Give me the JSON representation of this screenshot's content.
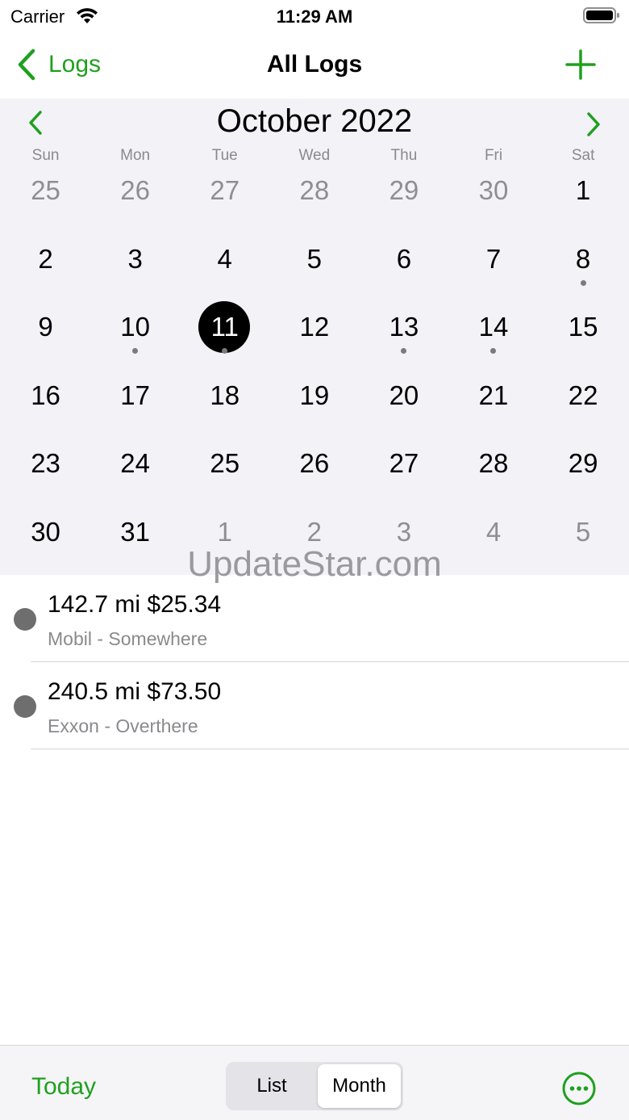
{
  "status_bar": {
    "carrier": "Carrier",
    "time": "11:29 AM"
  },
  "nav": {
    "back_label": "Logs",
    "title": "All Logs"
  },
  "calendar": {
    "month_label": "October 2022",
    "weekdays": [
      "Sun",
      "Mon",
      "Tue",
      "Wed",
      "Thu",
      "Fri",
      "Sat"
    ],
    "weeks": [
      [
        {
          "d": "25",
          "other": true
        },
        {
          "d": "26",
          "other": true
        },
        {
          "d": "27",
          "other": true
        },
        {
          "d": "28",
          "other": true
        },
        {
          "d": "29",
          "other": true
        },
        {
          "d": "30",
          "other": true
        },
        {
          "d": "1"
        }
      ],
      [
        {
          "d": "2"
        },
        {
          "d": "3"
        },
        {
          "d": "4"
        },
        {
          "d": "5"
        },
        {
          "d": "6"
        },
        {
          "d": "7"
        },
        {
          "d": "8",
          "dot": true
        }
      ],
      [
        {
          "d": "9"
        },
        {
          "d": "10",
          "dot": true
        },
        {
          "d": "11",
          "dot": true,
          "selected": true
        },
        {
          "d": "12"
        },
        {
          "d": "13",
          "dot": true
        },
        {
          "d": "14",
          "dot": true
        },
        {
          "d": "15"
        }
      ],
      [
        {
          "d": "16"
        },
        {
          "d": "17"
        },
        {
          "d": "18"
        },
        {
          "d": "19"
        },
        {
          "d": "20"
        },
        {
          "d": "21"
        },
        {
          "d": "22"
        }
      ],
      [
        {
          "d": "23"
        },
        {
          "d": "24"
        },
        {
          "d": "25"
        },
        {
          "d": "26"
        },
        {
          "d": "27"
        },
        {
          "d": "28"
        },
        {
          "d": "29"
        }
      ],
      [
        {
          "d": "30"
        },
        {
          "d": "31"
        },
        {
          "d": "1",
          "other": true
        },
        {
          "d": "2",
          "other": true
        },
        {
          "d": "3",
          "other": true
        },
        {
          "d": "4",
          "other": true
        },
        {
          "d": "5",
          "other": true
        }
      ]
    ]
  },
  "watermark": "UpdateStar.com",
  "logs": [
    {
      "title": "142.7 mi $25.34",
      "subtitle": "Mobil - Somewhere"
    },
    {
      "title": "240.5 mi $73.50",
      "subtitle": "Exxon - Overthere"
    }
  ],
  "toolbar": {
    "today_label": "Today",
    "segments": [
      "List",
      "Month"
    ],
    "selected_segment": "Month"
  },
  "colors": {
    "accent": "#1fa01f",
    "calendar_bg": "#f2f2f7",
    "selected_day": "#000000"
  }
}
